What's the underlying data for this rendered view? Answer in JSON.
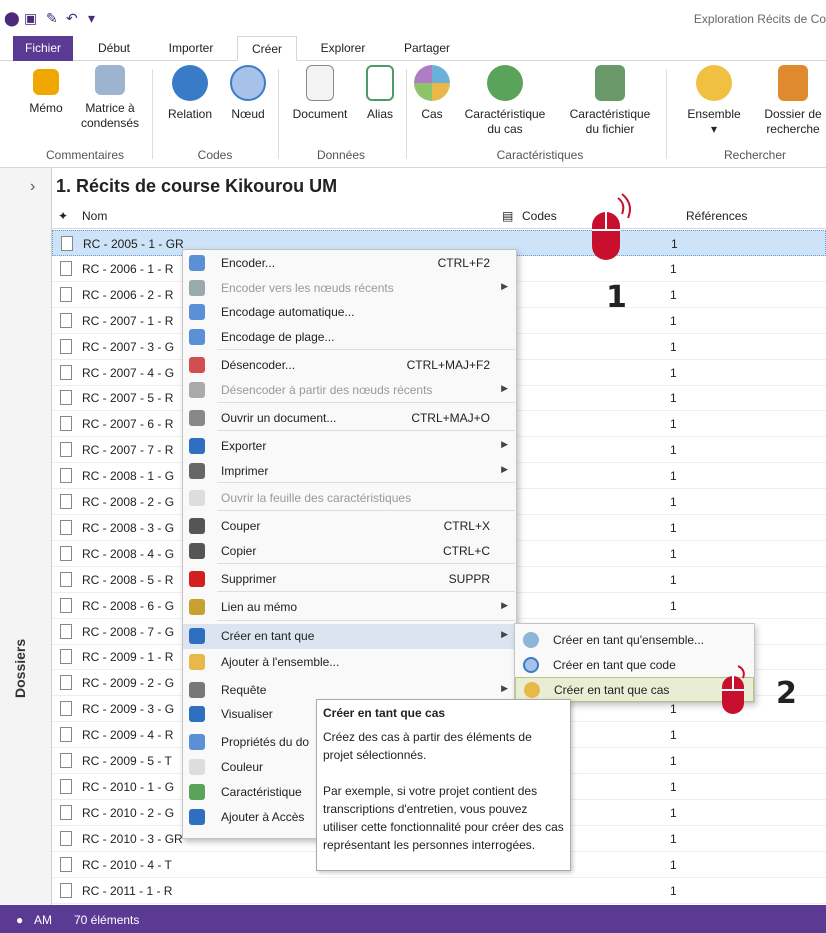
{
  "window": {
    "title": "Exploration Récits de Co"
  },
  "tabs": [
    "Fichier",
    "Début",
    "Importer",
    "Créer",
    "Explorer",
    "Partager"
  ],
  "ribbon": {
    "buttons": [
      {
        "label": "Mémo",
        "color": "#f0a800"
      },
      {
        "label": "Matrice à condensés",
        "color": "#9db4cf"
      },
      {
        "label": "Relation",
        "color": "#3a7bc8"
      },
      {
        "label": "Nœud",
        "color": "#a7c2e8"
      },
      {
        "label": "Document",
        "color": "#e6e6e6"
      },
      {
        "label": "Alias",
        "color": "#4e9a6b"
      },
      {
        "label": "Cas",
        "color": "#6ab0d8"
      },
      {
        "label": "Caractéristique du cas",
        "color": "#5aa35a"
      },
      {
        "label": "Caractéristique du fichier",
        "color": "#6a9a6a"
      },
      {
        "label": "Ensemble",
        "color": "#f0c040"
      },
      {
        "label": "Dossier de recherche",
        "color": "#e08a30"
      }
    ],
    "groups": [
      "Commentaires",
      "Codes",
      "Données",
      "Caractéristiques",
      "Rechercher"
    ]
  },
  "sidebar": {
    "label": "Dossiers"
  },
  "main": {
    "title": "1. Récits de course Kikourou UM",
    "columns": {
      "name": "Nom",
      "codes": "Codes",
      "refs": "Références"
    },
    "rows": [
      {
        "name": "RC - 2005 - 1 - GR",
        "count": "1"
      },
      {
        "name": "RC - 2006 - 1 - R",
        "count": "1"
      },
      {
        "name": "RC - 2006 - 2 - R",
        "count": "1"
      },
      {
        "name": "RC - 2007 - 1 - R",
        "count": "1"
      },
      {
        "name": "RC - 2007 - 3 - G",
        "count": "1"
      },
      {
        "name": "RC - 2007 - 4 - G",
        "count": "1"
      },
      {
        "name": "RC - 2007 - 5 - R",
        "count": "1"
      },
      {
        "name": "RC - 2007 - 6 - R",
        "count": "1"
      },
      {
        "name": "RC - 2007 - 7 - R",
        "count": "1"
      },
      {
        "name": "RC - 2008 - 1 - G",
        "count": "1"
      },
      {
        "name": "RC - 2008 - 2 - G",
        "count": "1"
      },
      {
        "name": "RC - 2008 - 3 - G",
        "count": "1"
      },
      {
        "name": "RC - 2008 - 4 - G",
        "count": "1"
      },
      {
        "name": "RC - 2008 - 5 - R",
        "count": "1"
      },
      {
        "name": "RC - 2008 - 6 - G",
        "count": "1"
      },
      {
        "name": "RC - 2008 - 7 - G",
        "count": ""
      },
      {
        "name": "RC - 2009 - 1 - R",
        "count": ""
      },
      {
        "name": "RC - 2009 - 2 - G",
        "count": ""
      },
      {
        "name": "RC - 2009 - 3 - G",
        "count": "1"
      },
      {
        "name": "RC - 2009 - 4 - R",
        "count": "1"
      },
      {
        "name": "RC - 2009 - 5 - T",
        "count": "1"
      },
      {
        "name": "RC - 2010 - 1 - G",
        "count": "1"
      },
      {
        "name": "RC - 2010 - 2 - G",
        "count": "1"
      },
      {
        "name": "RC - 2010 - 3 - GR",
        "count": "1"
      },
      {
        "name": "RC - 2010 - 4 - T",
        "count": "1"
      },
      {
        "name": "RC - 2011 - 1 - R",
        "count": "1"
      }
    ]
  },
  "context_menu": [
    {
      "label": "Encoder...",
      "shortcut": "CTRL+F2",
      "arrow": "",
      "disabled": false
    },
    {
      "label": "Encoder vers les nœuds récents",
      "shortcut": "",
      "arrow": "▶",
      "disabled": true
    },
    {
      "label": "Encodage automatique...",
      "shortcut": "",
      "arrow": "",
      "disabled": false
    },
    {
      "label": "Encodage de plage...",
      "shortcut": "",
      "arrow": "",
      "disabled": false
    },
    {
      "label": "Désencoder...",
      "shortcut": "CTRL+MAJ+F2",
      "arrow": "",
      "disabled": false
    },
    {
      "label": "Désencoder à partir des nœuds récents",
      "shortcut": "",
      "arrow": "▶",
      "disabled": true
    },
    {
      "label": "Ouvrir un document...",
      "shortcut": "CTRL+MAJ+O",
      "arrow": "",
      "disabled": false
    },
    {
      "label": "Exporter",
      "shortcut": "",
      "arrow": "▶",
      "disabled": false
    },
    {
      "label": "Imprimer",
      "shortcut": "",
      "arrow": "▶",
      "disabled": false
    },
    {
      "label": "Ouvrir la feuille des caractéristiques",
      "shortcut": "",
      "arrow": "",
      "disabled": true
    },
    {
      "label": "Couper",
      "shortcut": "CTRL+X",
      "arrow": "",
      "disabled": false
    },
    {
      "label": "Copier",
      "shortcut": "CTRL+C",
      "arrow": "",
      "disabled": false
    },
    {
      "label": "Supprimer",
      "shortcut": "SUPPR",
      "arrow": "",
      "disabled": false
    },
    {
      "label": "Lien au mémo",
      "shortcut": "",
      "arrow": "▶",
      "disabled": false
    },
    {
      "label": "Créer en tant que",
      "shortcut": "",
      "arrow": "▶",
      "disabled": false
    },
    {
      "label": "Ajouter à l'ensemble...",
      "shortcut": "",
      "arrow": "",
      "disabled": false
    },
    {
      "label": "Requête",
      "shortcut": "",
      "arrow": "▶",
      "disabled": false
    },
    {
      "label": "Visualiser",
      "shortcut": "",
      "arrow": "",
      "disabled": false
    },
    {
      "label": "Propriétés du do",
      "shortcut": "",
      "arrow": "",
      "disabled": false
    },
    {
      "label": "Couleur",
      "shortcut": "",
      "arrow": "",
      "disabled": false
    },
    {
      "label": "Caractéristique",
      "shortcut": "",
      "arrow": "",
      "disabled": false
    },
    {
      "label": "Ajouter à Accès",
      "shortcut": "",
      "arrow": "",
      "disabled": false
    }
  ],
  "submenu": [
    "Créer en tant qu'ensemble...",
    "Créer en tant que code",
    "Créer en tant que cas"
  ],
  "tooltip": {
    "title": "Créer en tant que cas",
    "line1": "Créez des cas à partir des éléments de projet sélectionnés.",
    "line2": "Par exemple, si votre projet contient des transcriptions d'entretien, vous pouvez utiliser cette fonctionnalité pour créer des cas représentant les personnes interrogées."
  },
  "annotations": {
    "one": "1",
    "two": "2"
  },
  "status": {
    "user": "AM",
    "count": "70 éléments"
  }
}
